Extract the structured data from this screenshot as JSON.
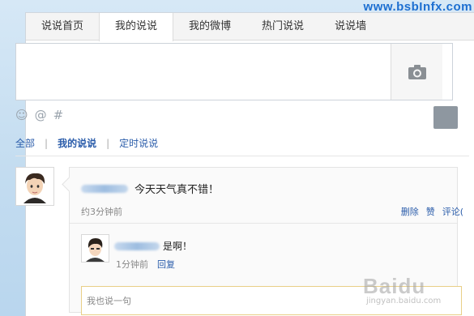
{
  "watermark": {
    "url": "www.bsbInfx.com",
    "baidu": "Bai",
    "baidu_paw": "du",
    "baidu_sub": "jingyan.baidu.com"
  },
  "tabs": [
    {
      "label": "说说首页"
    },
    {
      "label": "我的说说"
    },
    {
      "label": "我的微博"
    },
    {
      "label": "热门说说"
    },
    {
      "label": "说说墙"
    }
  ],
  "active_tab": "我的说说",
  "composer": {
    "value": "",
    "photo_icon": "camera-icon"
  },
  "tools": {
    "emoji_icon": "☺",
    "mention_icon": "@",
    "topic_icon": "#"
  },
  "filter": {
    "all": "全部",
    "mine": "我的说说",
    "scheduled": "定时说说",
    "separator": "|"
  },
  "post": {
    "text": "今天天气真不错！",
    "time": "约3分钟前",
    "actions": [
      "删除",
      "赞",
      "评论("
    ]
  },
  "reply": {
    "text": "是啊！",
    "time": "1分钟前",
    "reply_link": "回复"
  },
  "reply_input": {
    "placeholder": "我也说一句"
  },
  "colors": {
    "accent": "#2a5caa",
    "input_border": "#e9cf87"
  }
}
